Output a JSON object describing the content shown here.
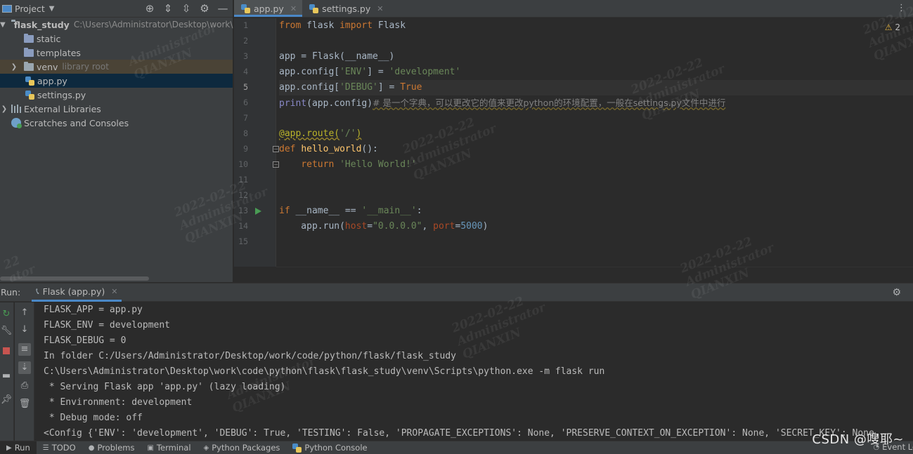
{
  "project_panel": {
    "title": "Project",
    "tree": [
      {
        "label": "flask_study",
        "note": "C:\\Users\\Administrator\\Desktop\\work\\",
        "kind": "root"
      },
      {
        "label": "static",
        "kind": "folder"
      },
      {
        "label": "templates",
        "kind": "folder"
      },
      {
        "label": "venv",
        "note": "library root",
        "kind": "folder"
      },
      {
        "label": "app.py",
        "kind": "python"
      },
      {
        "label": "settings.py",
        "kind": "python"
      },
      {
        "label": "External Libraries",
        "kind": "library"
      },
      {
        "label": "Scratches and Consoles",
        "kind": "scratch"
      }
    ]
  },
  "editor": {
    "tabs": [
      {
        "label": "app.py",
        "active": true
      },
      {
        "label": "settings.py",
        "active": false
      }
    ],
    "current_line": 5,
    "warning_count": "2",
    "line_numbers": [
      "1",
      "2",
      "3",
      "4",
      "5",
      "6",
      "7",
      "8",
      "9",
      "10",
      "11",
      "12",
      "13",
      "14",
      "15"
    ],
    "code": {
      "l1": [
        "from",
        " flask ",
        "import",
        " Flask"
      ],
      "l3": "app = Flask(__name__)",
      "l4": [
        "app.config[",
        "'ENV'",
        "] = ",
        "'development'"
      ],
      "l5": [
        "app.config[",
        "'DEBUG'",
        "] = ",
        "True"
      ],
      "l6": [
        "print",
        "(app.config)",
        "# 是一个字典，可以更改它的值来更改python的环境配置，一般在settings.py文件中进行"
      ],
      "l8": [
        "@app.route(",
        "'/'",
        ")"
      ],
      "l9": [
        "def",
        " ",
        "hello_world",
        "():"
      ],
      "l10": [
        "    ",
        "return",
        " ",
        "'Hello World!'"
      ],
      "l13": [
        "if",
        " __name__ == ",
        "'__main__'",
        ":"
      ],
      "l14": [
        "    app.run(",
        "host",
        "=",
        "\"0.0.0.0\"",
        ", ",
        "port",
        "=",
        "5000",
        ")"
      ]
    }
  },
  "run_panel": {
    "label": "Run:",
    "tab": "Flask (app.py)",
    "output": [
      "FLASK_APP = app.py",
      "FLASK_ENV = development",
      "FLASK_DEBUG = 0",
      "In folder C:/Users/Administrator/Desktop/work/code/python/flask/flask_study",
      "C:\\Users\\Administrator\\Desktop\\work\\code\\python\\flask\\flask_study\\venv\\Scripts\\python.exe -m flask run",
      " * Serving Flask app 'app.py' (lazy loading)",
      " * Environment: development",
      " * Debug mode: off",
      "<Config {'ENV': 'development', 'DEBUG': True, 'TESTING': False, 'PROPAGATE_EXCEPTIONS': None, 'PRESERVE_CONTEXT_ON_EXCEPTION': None, 'SECRET_KEY': None,"
    ]
  },
  "bottom_strip": {
    "items": [
      "Run",
      "TODO",
      "Problems",
      "Terminal",
      "Python Packages",
      "Python Console"
    ],
    "active": "Run",
    "event_log": "Event Lo"
  },
  "watermark": {
    "date": "2022-02-22",
    "user": "Administrator",
    "org": "QIANXIN",
    "fragment": "22\nator"
  },
  "overlay": "CSDN @嗖耶~",
  "colors": {
    "keyword": "#cc7832",
    "string": "#6a8759",
    "number": "#6897bb",
    "decorator": "#bbb529",
    "function": "#ffc66d",
    "param": "#aa4926",
    "accent": "#4a88c7",
    "run_green": "#499c54"
  }
}
